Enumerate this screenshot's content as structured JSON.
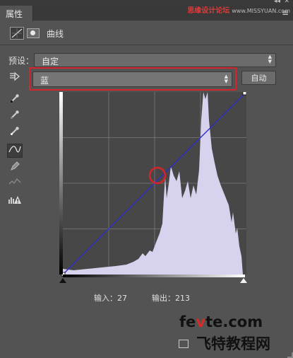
{
  "panel": {
    "tab_label": "属性",
    "watermark_top": "思缘设计论坛",
    "watermark_top_url": "www.MISSYUAN.com",
    "collapse_glyph": "◂◂",
    "close_glyph": "✕",
    "menu_glyph": "≡"
  },
  "header": {
    "adjustment_icon": "curves-adjustment-icon",
    "mask_icon": "layer-mask-icon",
    "title": "曲线"
  },
  "preset": {
    "label": "预设：",
    "value": "自定"
  },
  "channel": {
    "value": "蓝",
    "auto_label": "自动"
  },
  "tools": [
    {
      "name": "on-image-adjust-icon",
      "glyph": "☚"
    },
    {
      "name": "black-point-eyedropper-icon",
      "glyph": "✎"
    },
    {
      "name": "gray-point-eyedropper-icon",
      "glyph": "✎"
    },
    {
      "name": "white-point-eyedropper-icon",
      "glyph": "✎"
    },
    {
      "name": "edit-points-curve-icon",
      "glyph": "∿"
    },
    {
      "name": "draw-pencil-icon",
      "glyph": "✏"
    },
    {
      "name": "smooth-curve-icon",
      "glyph": "≈"
    },
    {
      "name": "clipping-warning-icon",
      "glyph": "⚠"
    }
  ],
  "curve": {
    "input_label": "输入：",
    "input_value": "27",
    "output_label": "输出：",
    "output_value": "213",
    "line_color": "#2e2ec8",
    "histogram_color": "#d7d3ef",
    "highlight_color": "#d6242c"
  },
  "watermark_bottom": {
    "part1": "fe",
    "part2": "v",
    "part3": "te.com",
    "cn": "飞特教程网"
  }
}
